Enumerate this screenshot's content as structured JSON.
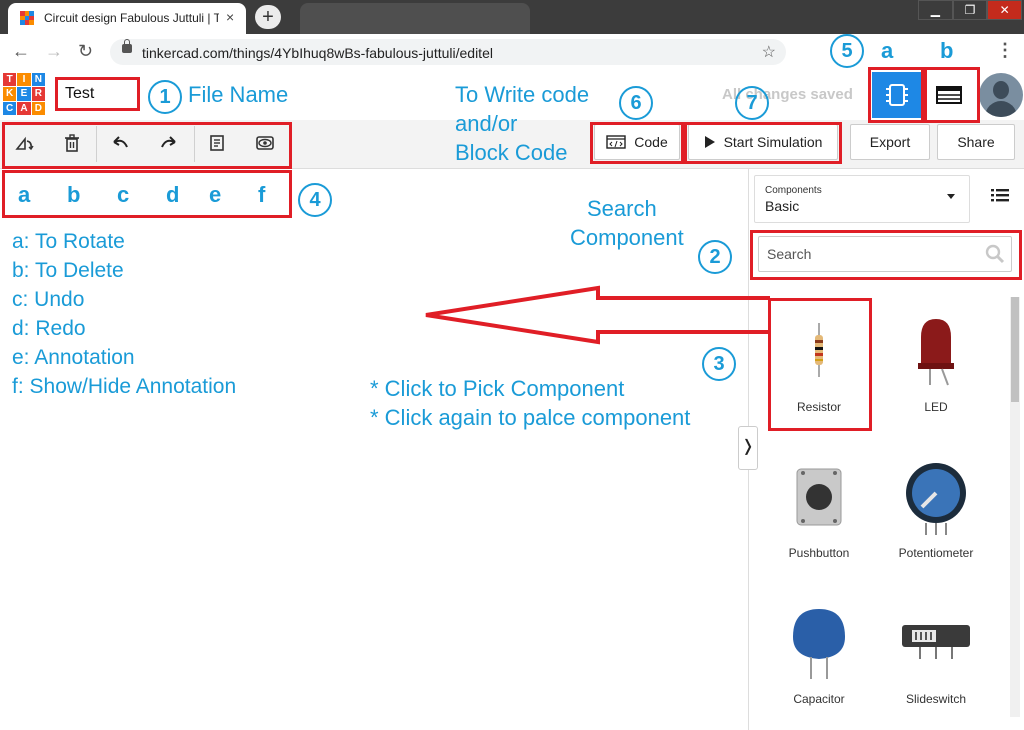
{
  "browser": {
    "tab_title": "Circuit design Fabulous Juttuli | T",
    "tab_close": "×",
    "new_tab": "+",
    "url": "tinkercad.com/things/4YbIhuq8wBs-fabulous-juttuli/editel",
    "window_controls": {
      "minimize": "▁",
      "maximize": "❐",
      "close": "✕"
    }
  },
  "header": {
    "logo_letters": [
      "T",
      "I",
      "N",
      "K",
      "E",
      "R",
      "C",
      "A",
      "D"
    ],
    "logo_colors": [
      "#e53935",
      "#fb8c00",
      "#1e88e5",
      "#fb8c00",
      "#1e88e5",
      "#e53935",
      "#1e88e5",
      "#e53935",
      "#fb8c00"
    ],
    "file_name": "Test",
    "save_status": "All changes saved",
    "accent_color": "#1e88e5"
  },
  "toolbar": {
    "tools": [
      "rotate-icon",
      "trash-icon",
      "undo-icon",
      "redo-icon",
      "note-icon",
      "eye-icon"
    ],
    "code_label": "Code",
    "sim_label": "Start Simulation",
    "export_label": "Export",
    "share_label": "Share"
  },
  "panel": {
    "select_label": "Components",
    "select_value": "Basic",
    "search_placeholder": "Search",
    "collapse_glyph": "❭",
    "components": [
      {
        "name": "Resistor"
      },
      {
        "name": "LED"
      },
      {
        "name": "Pushbutton"
      },
      {
        "name": "Potentiometer"
      },
      {
        "name": "Capacitor"
      },
      {
        "name": "Slideswitch"
      }
    ]
  },
  "annotations": {
    "n1": "1",
    "n2": "2",
    "n3": "3",
    "n4": "4",
    "n5": "5",
    "n6": "6",
    "n7": "7",
    "file_name_label": "File Name",
    "search_label_1": "Search",
    "search_label_2": "Component",
    "code_label_1": "To Write code",
    "code_label_2": "and/or",
    "code_label_3": "Block Code",
    "view_a": "a",
    "view_b": "b",
    "tool_letters": [
      "a",
      "b",
      "c",
      "d",
      "e",
      "f"
    ],
    "legend": [
      "a: To Rotate",
      "b: To Delete",
      "c: Undo",
      "d: Redo",
      "e: Annotation",
      "f: Show/Hide Annotation"
    ],
    "pick_1": "* Click to Pick Component",
    "pick_2": "* Click again to palce component",
    "mark_color": "#e01e26",
    "text_color": "#1a9bd7"
  }
}
